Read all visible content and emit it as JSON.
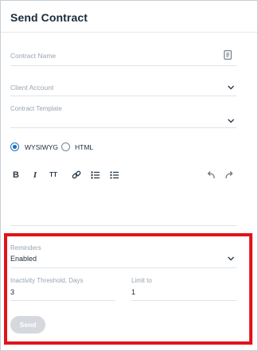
{
  "header": {
    "title": "Send Contract"
  },
  "form": {
    "contract_name": {
      "placeholder": "Contract Name",
      "icon": "document-icon"
    },
    "client_account": {
      "placeholder": "Client Account"
    },
    "contract_template": {
      "label": "Contract Template"
    },
    "format": {
      "options": [
        {
          "label": "WYSIWYG",
          "selected": true
        },
        {
          "label": "HTML",
          "selected": false
        }
      ]
    },
    "toolbar": {
      "bold": "B",
      "italic": "I",
      "text_size": "TT",
      "icons": [
        "bold-icon",
        "italic-icon",
        "text-size-icon",
        "link-icon",
        "bulleted-list-icon",
        "numbered-list-icon",
        "undo-icon",
        "redo-icon"
      ]
    },
    "reminders": {
      "label": "Reminders",
      "value": "Enabled"
    },
    "inactivity_threshold": {
      "label": "Inactivity Threshold, Days",
      "value": "3"
    },
    "limit_to": {
      "label": "Limit to",
      "value": "1"
    },
    "send_label": "Send"
  },
  "colors": {
    "accent": "#1a73c9",
    "highlight": "#e0141c",
    "send_disabled": "#d5d9de"
  }
}
